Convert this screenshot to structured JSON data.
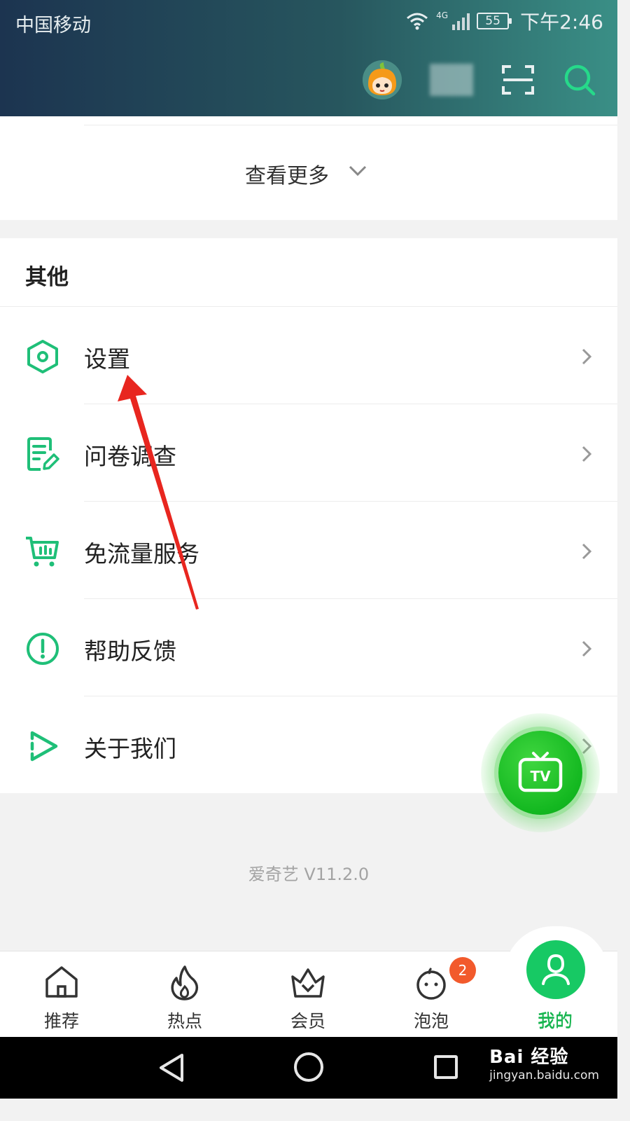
{
  "status_bar": {
    "carrier": "中国移动",
    "network": "4G",
    "battery": "55",
    "time": "下午2:46"
  },
  "more": {
    "label": "查看更多"
  },
  "other_section": {
    "title": "其他",
    "items": [
      {
        "label": "设置",
        "icon": "settings-hexagon-icon"
      },
      {
        "label": "问卷调查",
        "icon": "survey-document-icon"
      },
      {
        "label": "免流量服务",
        "icon": "cart-icon"
      },
      {
        "label": "帮助反馈",
        "icon": "exclamation-circle-icon"
      },
      {
        "label": "关于我们",
        "icon": "play-triangle-icon"
      }
    ]
  },
  "version": "爱奇艺 V11.2.0",
  "tv_float": {
    "label": "TV"
  },
  "bottom_nav": {
    "items": [
      {
        "label": "推荐",
        "icon": "home-icon"
      },
      {
        "label": "热点",
        "icon": "flame-icon"
      },
      {
        "label": "会员",
        "icon": "crown-icon"
      },
      {
        "label": "泡泡",
        "icon": "bubble-face-icon",
        "badge": "2"
      },
      {
        "label": "我的",
        "icon": "user-icon",
        "active": true
      }
    ]
  },
  "watermark": {
    "brand": "Bai 经验",
    "url": "jingyan.baidu.com"
  },
  "colors": {
    "accent": "#18b550",
    "badge": "#f25a2c",
    "icon_green": "#1fbf78"
  }
}
